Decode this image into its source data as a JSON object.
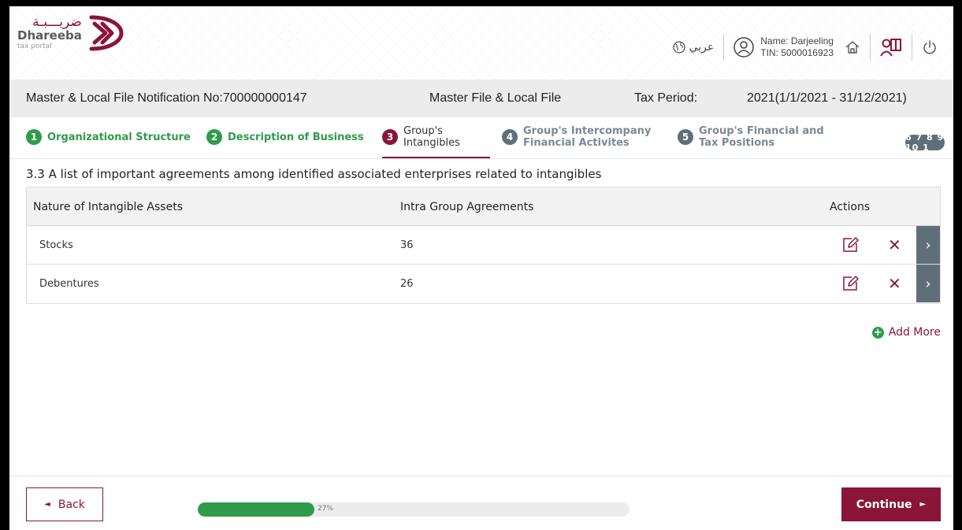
{
  "header": {
    "logo_arabic": "ضريـــبـة",
    "logo_name": "Dhareeba",
    "logo_sub": "tax portal",
    "language_label": "عربي",
    "user_name": "Name: Darjeeling",
    "user_tin": "TIN: 5000016923"
  },
  "info": {
    "notification": "Master & Local File Notification No:700000000147",
    "file_type": "Master File & Local File",
    "tax_period_label": "Tax Period:",
    "tax_period_value": "2021(1/1/2021 - 31/12/2021)"
  },
  "steps": [
    {
      "num": "1",
      "label": "Organizational Structure",
      "status": "done"
    },
    {
      "num": "2",
      "label": "Description of Business",
      "status": "done"
    },
    {
      "num": "3",
      "label_line1": "Group's",
      "label_line2": "Intangibles",
      "status": "current"
    },
    {
      "num": "4",
      "label_line1": "Group's Intercompany",
      "label_line2": "Financial Activites",
      "status": "todo"
    },
    {
      "num": "5",
      "label_line1": "Group's Financial and",
      "label_line2": "Tax Positions",
      "status": "todo"
    }
  ],
  "more_steps": "6 7 8 9 10 1",
  "section_title": "3.3 A list of important agreements among identified associated enterprises related to intangibles",
  "table": {
    "headers": [
      "Nature of Intangible Assets",
      "Intra Group Agreements",
      "Actions"
    ],
    "rows": [
      {
        "nature": "Stocks",
        "agreements": "36"
      },
      {
        "nature": "Debentures",
        "agreements": "26"
      }
    ]
  },
  "add_more_label": "Add More",
  "footer": {
    "back_label": "Back",
    "progress_text": "27%",
    "progress_value": 0.27,
    "continue_label": "Continue"
  },
  "colors": {
    "brand": "#8a1538",
    "success": "#2e9c4a",
    "muted": "#5f6f7a"
  }
}
